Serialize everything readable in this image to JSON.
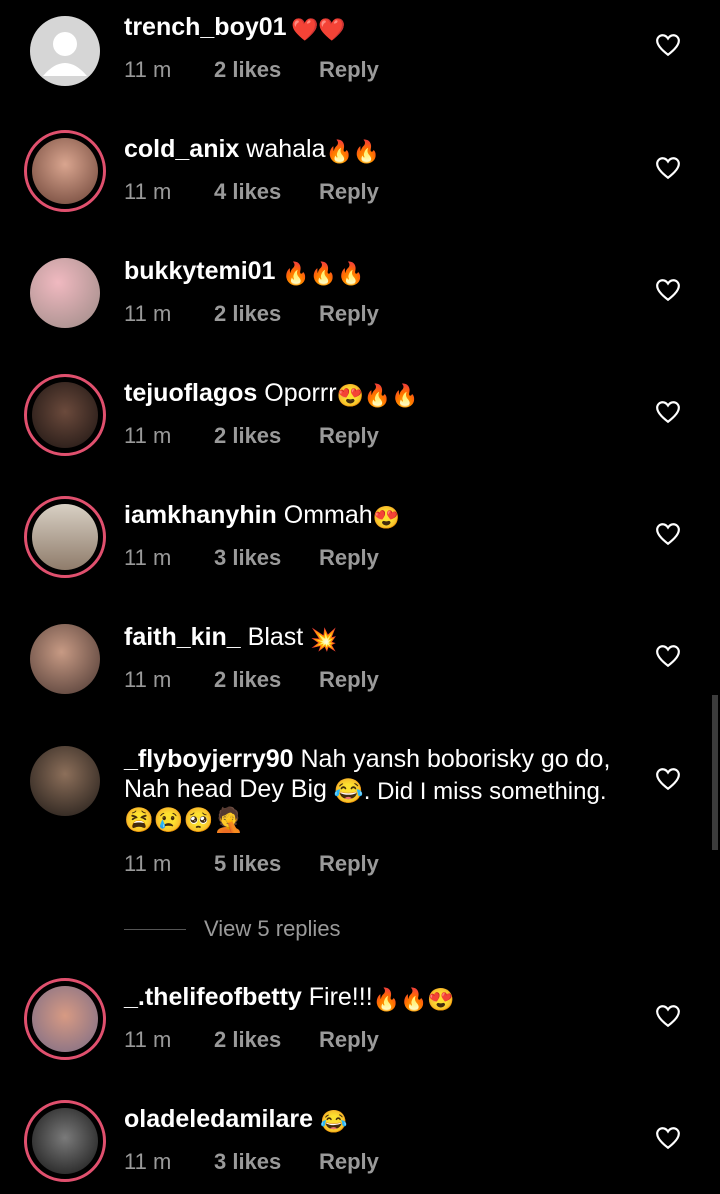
{
  "comments": [
    {
      "user": "trench_boy01",
      "text": "",
      "emoji": "❤️❤️",
      "time": "11 m",
      "likes": "2 likes",
      "reply": "Reply",
      "ring": false,
      "avatar_color": "#d9d9d9"
    },
    {
      "user": "cold_anix",
      "text": " wahala",
      "emoji": "🔥🔥",
      "time": "11 m",
      "likes": "4 likes",
      "reply": "Reply",
      "ring": true,
      "avatar_color": "#b07b66"
    },
    {
      "user": "bukkytemi01",
      "text": " ",
      "emoji": "🔥🔥🔥",
      "time": "11 m",
      "likes": "2 likes",
      "reply": "Reply",
      "ring": false,
      "avatar_color": "#c9a7a9"
    },
    {
      "user": "tejuoflagos",
      "text": " Oporrr",
      "emoji": "😍🔥🔥",
      "time": "11 m",
      "likes": "2 likes",
      "reply": "Reply",
      "ring": true,
      "avatar_color": "#3a2a25"
    },
    {
      "user": "iamkhanyhin",
      "text": " Ommah",
      "emoji": "😍",
      "time": "11 m",
      "likes": "3 likes",
      "reply": "Reply",
      "ring": true,
      "avatar_color": "#b7a99a"
    },
    {
      "user": "faith_kin_",
      "text": " Blast ",
      "emoji": "💥",
      "time": "11 m",
      "likes": "2 likes",
      "reply": "Reply",
      "ring": false,
      "avatar_color": "#8c6f63"
    },
    {
      "user": "_flyboyjerry90",
      "text": " Nah yansh boborisky go do, Nah head Dey Big ",
      "emoji": "😂. Did I miss something. 😫😢🥺🤦",
      "time": "11 m",
      "likes": "5 likes",
      "reply": "Reply",
      "ring": false,
      "avatar_color": "#5b4a3e"
    },
    {
      "user": "_.thelifeofbetty",
      "text": " Fire!!!",
      "emoji": "🔥🔥😍",
      "time": "11 m",
      "likes": "2 likes",
      "reply": "Reply",
      "ring": true,
      "avatar_color": "#c98b6f"
    },
    {
      "user": "oladeledamilare",
      "text": " ",
      "emoji": "😂",
      "time": "11 m",
      "likes": "3 likes",
      "reply": "Reply",
      "ring": true,
      "avatar_color": "#3d3d3d"
    }
  ],
  "view_replies": "View 5 replies"
}
